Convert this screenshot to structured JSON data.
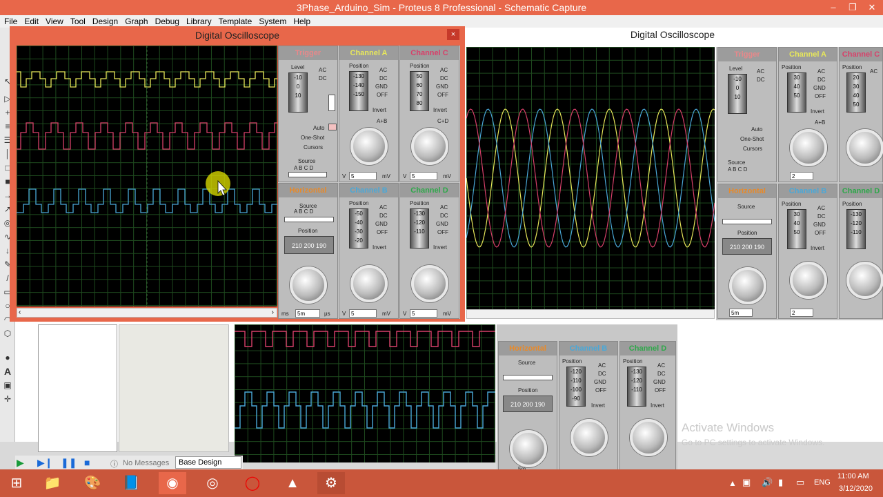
{
  "window": {
    "title": "3Phase_Arduino_Sim - Proteus 8 Professional - Schematic Capture",
    "min": "–",
    "max": "❐",
    "close": "✕"
  },
  "menu": [
    "File",
    "Edit",
    "View",
    "Tool",
    "Design",
    "Graph",
    "Debug",
    "Library",
    "Template",
    "System",
    "Help"
  ],
  "dialog_front": {
    "title": "Digital Oscilloscope",
    "close": "×"
  },
  "dialog_back": {
    "title": "Digital Oscilloscope"
  },
  "panels": {
    "trigger": "Trigger",
    "channel_a": "Channel A",
    "channel_b": "Channel B",
    "channel_c": "Channel C",
    "channel_d": "Channel D",
    "horizontal": "Horizontal"
  },
  "labels": {
    "level": "Level",
    "position": "Position",
    "source": "Source",
    "ac": "AC",
    "dc": "DC",
    "gnd": "GND",
    "off": "OFF",
    "invert": "Invert",
    "auto": "Auto",
    "one_shot": "One-Shot",
    "cursors": "Cursors",
    "a_plus_b": "A+B",
    "c_plus_d": "C+D",
    "abcd": "A B C D",
    "v": "V",
    "mv": "mV",
    "ms": "ms",
    "us": "µs"
  },
  "values": {
    "trig_level": [
      "-10",
      "0",
      "10"
    ],
    "cha_pos": [
      "-130",
      "-140",
      "-150"
    ],
    "chc_pos": [
      "50",
      "60",
      "70",
      "80"
    ],
    "chb_pos": [
      "-50",
      "-40",
      "-30",
      "-20"
    ],
    "chd_pos": [
      "-130",
      "-120",
      "-110"
    ],
    "hpos": "210 200 190",
    "cha_field": "5",
    "chc_field": "5",
    "chb_field": "5",
    "chd_field": "5",
    "h_field": "5m",
    "bg_cha_pos": [
      "30",
      "40",
      "50"
    ],
    "bg_chc_pos": [
      "20",
      "30",
      "40",
      "50"
    ],
    "bg_chb_pos": [
      "30",
      "40",
      "50"
    ],
    "bg_chd_pos": [
      "-130",
      "-120",
      "-110"
    ],
    "bg_cha_field": "2",
    "bg_chb_field": "2",
    "low_chb_pos": [
      "-120",
      "-110",
      "-100",
      "-90"
    ],
    "low_chd_pos": [
      "-130",
      "-120",
      "-110"
    ]
  },
  "status": {
    "messages": "No Messages",
    "design": "Base Design"
  },
  "watermark": {
    "line1": "Activate Windows",
    "line2": "Go to PC settings to activate Windows."
  },
  "clock": {
    "time": "11:00 AM",
    "date": "3/12/2020",
    "lang": "ENG"
  },
  "colors": {
    "ch_a": "#e8e85a",
    "ch_b": "#4aa8d8",
    "ch_c": "#d8406a",
    "ch_d": "#2ea84a",
    "trigger": "#e8888a",
    "horizontal": "#e88a2a",
    "accent": "#e8674a"
  }
}
